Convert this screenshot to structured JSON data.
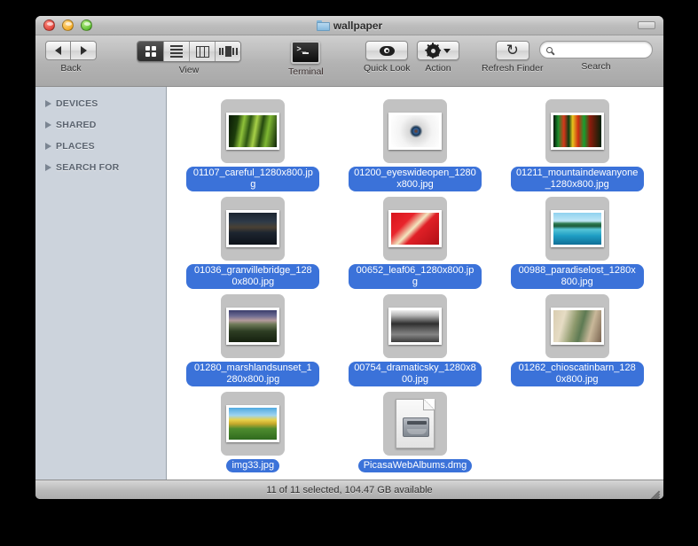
{
  "window": {
    "title": "wallpaper",
    "folder_icon": "folder-icon",
    "traffic_lights": {
      "close": "close-button",
      "minimize": "minimize-button",
      "zoom": "zoom-button"
    }
  },
  "toolbar": {
    "back_label": "Back",
    "back_icon": "arrow-left-icon",
    "forward_icon": "arrow-right-icon",
    "view_label": "View",
    "view_modes": [
      {
        "name": "icon-view",
        "icon": "grid-icon",
        "active": true
      },
      {
        "name": "list-view",
        "icon": "list-icon",
        "active": false
      },
      {
        "name": "column-view",
        "icon": "columns-icon",
        "active": false
      },
      {
        "name": "coverflow-view",
        "icon": "coverflow-icon",
        "active": false
      }
    ],
    "terminal_label": "Terminal",
    "terminal_icon": "terminal-icon",
    "terminal_prompt": ">_",
    "quicklook_label": "Quick Look",
    "quicklook_icon": "eye-icon",
    "action_label": "Action",
    "action_icon": "gear-icon",
    "refresh_label": "Refresh Finder",
    "refresh_icon": "refresh-icon",
    "refresh_glyph": "↻",
    "search_label": "Search",
    "search_placeholder": "",
    "search_value": "",
    "search_icon": "search-icon"
  },
  "sidebar": {
    "items": [
      {
        "label": "DEVICES",
        "name": "sidebar-section-devices",
        "expanded": false
      },
      {
        "label": "SHARED",
        "name": "sidebar-section-shared",
        "expanded": false
      },
      {
        "label": "PLACES",
        "name": "sidebar-section-places",
        "expanded": false
      },
      {
        "label": "SEARCH FOR",
        "name": "sidebar-section-search-for",
        "expanded": false
      }
    ]
  },
  "files": [
    {
      "name": "01107_careful_1280x800.jpg",
      "type": "image",
      "selected": true,
      "thumb": "green-stalks"
    },
    {
      "name": "01200_eyeswideopen_1280x800.jpg",
      "type": "image",
      "selected": true,
      "thumb": "eye-closeup"
    },
    {
      "name": "01211_mountaindewanyone_1280x800.jpg",
      "type": "image",
      "selected": true,
      "thumb": "green-red-abstract"
    },
    {
      "name": "01036_granvillebridge_1280x800.jpg",
      "type": "image",
      "selected": true,
      "thumb": "night-bridge"
    },
    {
      "name": "00652_leaf06_1280x800.jpg",
      "type": "image",
      "selected": true,
      "thumb": "red-leaf"
    },
    {
      "name": "00988_paradiselost_1280x800.jpg",
      "type": "image",
      "selected": true,
      "thumb": "tropical-island"
    },
    {
      "name": "01280_marshlandsunset_1280x800.jpg",
      "type": "image",
      "selected": true,
      "thumb": "marsh-sunset"
    },
    {
      "name": "00754_dramaticsky_1280x800.jpg",
      "type": "image",
      "selected": true,
      "thumb": "bw-dramatic-sky"
    },
    {
      "name": "01262_chioscatinbarn_1280x800.jpg",
      "type": "image",
      "selected": true,
      "thumb": "barn-door"
    },
    {
      "name": "img33.jpg",
      "type": "image",
      "selected": true,
      "thumb": "yellow-fields"
    },
    {
      "name": "PicasaWebAlbums.dmg",
      "type": "disk-image",
      "selected": true,
      "thumb": "disk-image-doc"
    }
  ],
  "statusbar": {
    "text": "11 of 11 selected, 104.47 GB available",
    "resize_grip": "resize-grip"
  },
  "colors": {
    "selection_blue": "#3b72d9",
    "sidebar_bg": "#ccd3dc",
    "desktop_bg": "#000000",
    "content_bg": "#ffffff"
  }
}
